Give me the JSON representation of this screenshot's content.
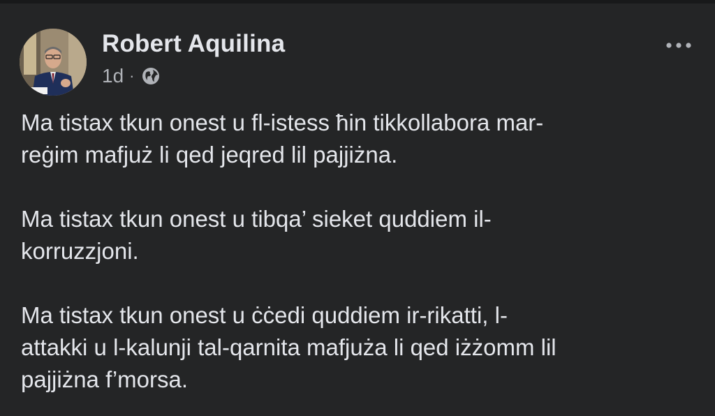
{
  "post": {
    "author_name": "Robert Aquilina",
    "timestamp": "1d",
    "separator": "·",
    "audience_icon": "globe-icon",
    "more_icon": "more-horizontal-icon",
    "paragraphs": [
      "Ma tistax tkun onest u fl-istess ħin tikkollabora mar-\nreġim mafjuż li qed jeqred lil pajjiżna.",
      "Ma tistax tkun onest u tibqa’ sieket quddiem il-\nkorruzzjoni.",
      "Ma tistax tkun onest u ċċedi quddiem ir-rikatti, l-\nattakki u l-kalunji tal-qarnita mafjuża li qed iżżomm lil\npajjiżna f’morsa."
    ]
  },
  "colors": {
    "background": "#242526",
    "text_primary": "#e4e6eb",
    "text_secondary": "#b0b3b8"
  }
}
